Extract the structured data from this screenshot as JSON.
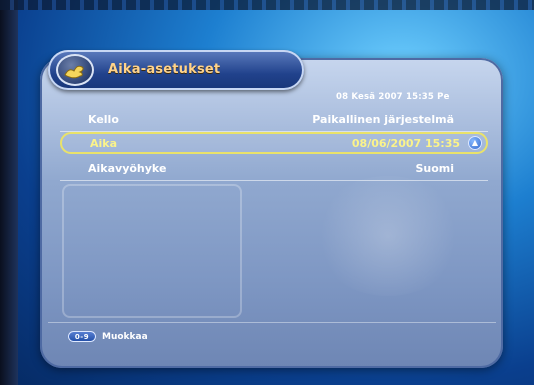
{
  "screen": {
    "title": "Aika-asetukset",
    "datetime": "08 Kesä 2007 15:35 Pe"
  },
  "settings": [
    {
      "label": "Kello",
      "value": "Paikallinen järjestelmä"
    },
    {
      "label": "Aika",
      "value": "08/06/2007 15:35",
      "selected": true
    },
    {
      "label": "Aikavyöhyke",
      "value": "Suomi"
    }
  ],
  "footer": {
    "key_label": "0-9",
    "action_label": "Muokkaa"
  },
  "icons": {
    "badge": "hand-icon",
    "scroll": "scroll-arrow-icon"
  },
  "colors": {
    "title": "#ffd38a",
    "selected": "#fbf38a",
    "panel": "#90a8cf",
    "background": "#1d7fd0"
  }
}
